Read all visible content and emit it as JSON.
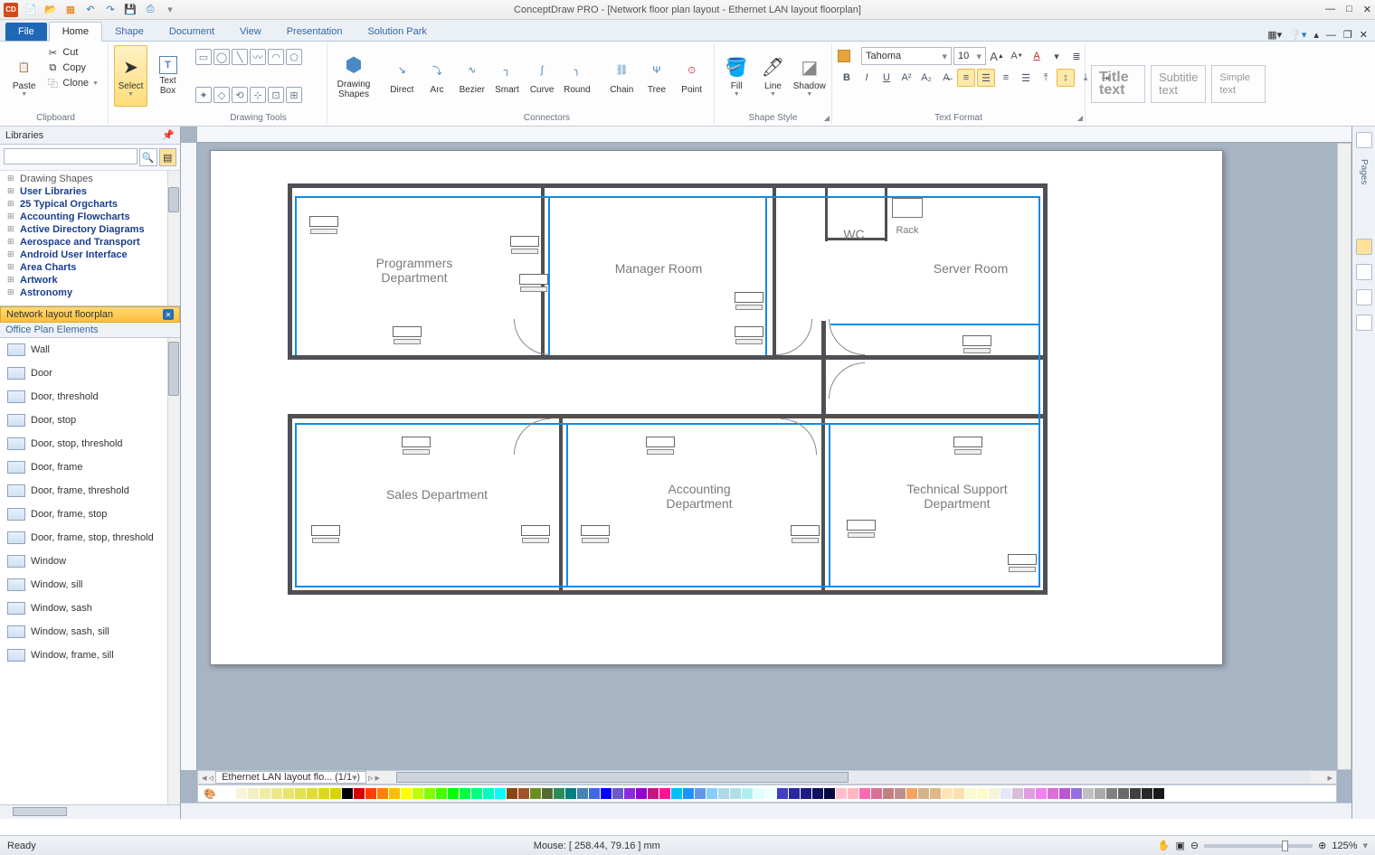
{
  "app": {
    "title": "ConceptDraw PRO - [Network floor plan layout - Ethernet LAN layout floorplan]"
  },
  "tabs": {
    "file": "File",
    "items": [
      "Home",
      "Shape",
      "Document",
      "View",
      "Presentation",
      "Solution Park"
    ],
    "active": "Home"
  },
  "ribbon": {
    "clipboard": {
      "label": "Clipboard",
      "paste": "Paste",
      "cut": "Cut",
      "copy": "Copy",
      "clone": "Clone"
    },
    "select": {
      "label": "Select"
    },
    "textbox": {
      "label": "Text\nBox"
    },
    "drawtools": {
      "label": "Drawing Tools"
    },
    "drawshapes": {
      "label": "Drawing\nShapes"
    },
    "connectors": {
      "label": "Connectors",
      "items": [
        "Direct",
        "Arc",
        "Bezier",
        "Smart",
        "Curve",
        "Round",
        "Chain",
        "Tree",
        "Point"
      ]
    },
    "shapestyle": {
      "label": "Shape Style",
      "fill": "Fill",
      "line": "Line",
      "shadow": "Shadow"
    },
    "textformat": {
      "label": "Text Format",
      "font": "Tahoma",
      "size": "10"
    },
    "styles": {
      "title": "Title\ntext",
      "subtitle": "Subtitle\ntext",
      "simple": "Simple\ntext"
    }
  },
  "libraries": {
    "panel": "Libraries",
    "tree_root": "Drawing Shapes",
    "tree": [
      "User Libraries",
      "25 Typical Orgcharts",
      "Accounting Flowcharts",
      "Active Directory Diagrams",
      "Aerospace and Transport",
      "Android User Interface",
      "Area Charts",
      "Artwork",
      "Astronomy"
    ],
    "open_lib": "Network layout floorplan",
    "sub_lib": "Office Plan Elements",
    "stencils": [
      "Wall",
      "Door",
      "Door, threshold",
      "Door, stop",
      "Door, stop, threshold",
      "Door, frame",
      "Door, frame, threshold",
      "Door, frame, stop",
      "Door, frame, stop, threshold",
      "Window",
      "Window, sill",
      "Window, sash",
      "Window, sash, sill",
      "Window, frame, sill"
    ]
  },
  "floorplan": {
    "rooms": {
      "programmers": "Programmers\nDepartment",
      "manager": "Manager Room",
      "wc": "WC",
      "server": "Server Room",
      "rack": "Rack",
      "sales": "Sales Department",
      "accounting": "Accounting\nDepartment",
      "techsupport": "Technical Support\nDepartment"
    }
  },
  "doc_tabs": {
    "current": "Ethernet LAN layout flo...",
    "page": "(1/1"
  },
  "status": {
    "ready": "Ready",
    "mouse_label": "Mouse: [ 258.44, 79.16 ] mm",
    "zoom": "125%"
  },
  "pages_label": "Pages"
}
